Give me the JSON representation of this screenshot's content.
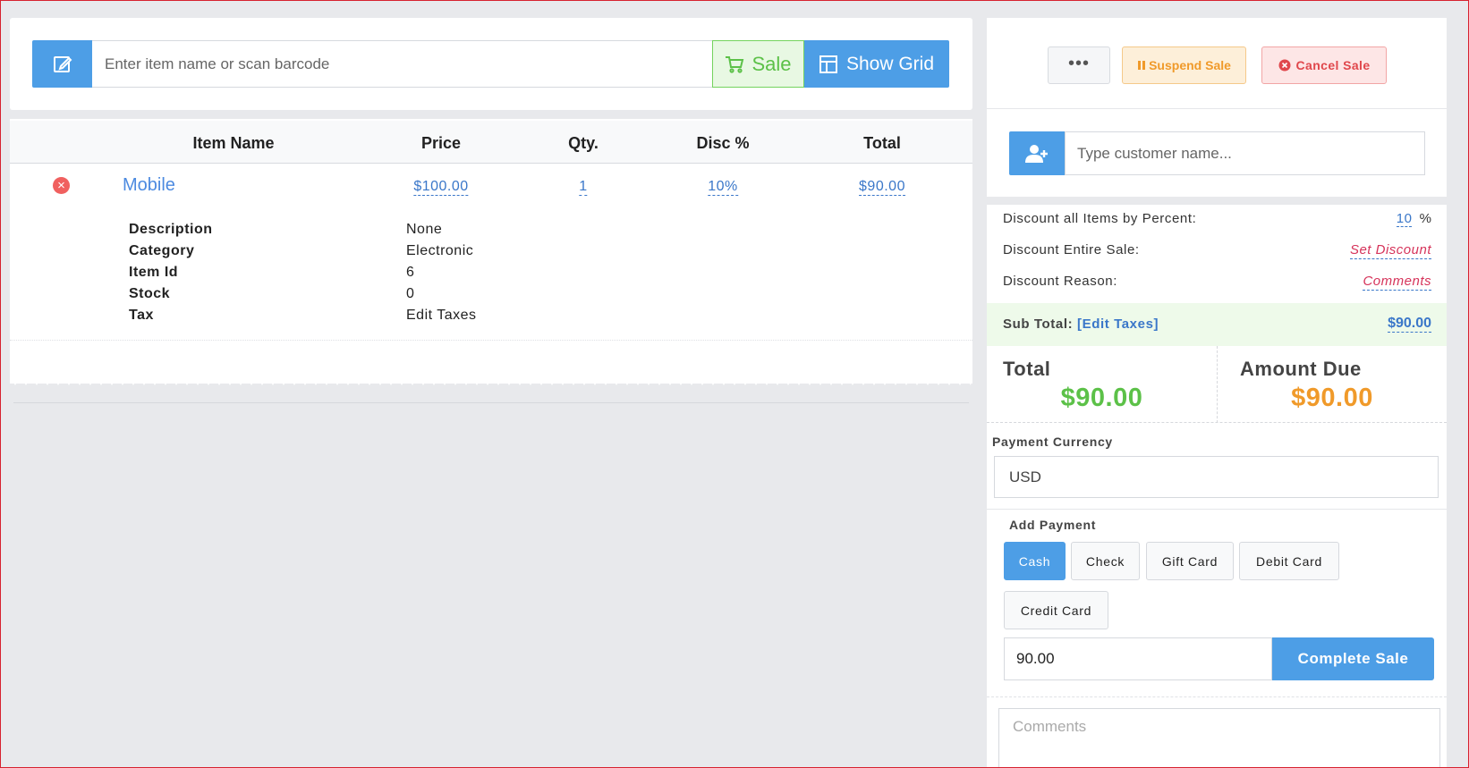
{
  "search": {
    "placeholder": "Enter item name or scan barcode",
    "sale_label": "Sale",
    "show_grid_label": "Show Grid"
  },
  "cart": {
    "columns": [
      "Item Name",
      "Price",
      "Qty.",
      "Disc %",
      "Total"
    ],
    "items": [
      {
        "name": "Mobile",
        "price": "$100.00",
        "qty": "1",
        "discount": "10%",
        "total": "$90.00",
        "details": [
          {
            "label": "Description",
            "value": "None"
          },
          {
            "label": "Category",
            "value": "Electronic"
          },
          {
            "label": "Item Id",
            "value": "6"
          },
          {
            "label": "Stock",
            "value": "0"
          },
          {
            "label": "Tax",
            "value": "Edit Taxes"
          }
        ]
      }
    ]
  },
  "actions": {
    "more_label": "•••",
    "suspend_label": "Suspend Sale",
    "cancel_label": "Cancel Sale"
  },
  "customer": {
    "placeholder": "Type customer name..."
  },
  "summary": {
    "discount_all_label": "Discount all Items by Percent:",
    "discount_all_value": "10",
    "percent_sign": "%",
    "discount_entire_label": "Discount Entire Sale:",
    "discount_entire_link": "Set Discount",
    "discount_reason_label": "Discount Reason:",
    "discount_reason_link": "Comments",
    "subtotal_label": "Sub Total:",
    "edit_taxes_label": "[Edit Taxes]",
    "subtotal_value": "$90.00",
    "total_label": "Total",
    "total_value": "$90.00",
    "amount_due_label": "Amount Due",
    "amount_due_value": "$90.00"
  },
  "payment": {
    "currency_label": "Payment Currency",
    "currency_value": "USD",
    "add_payment_label": "Add Payment",
    "types": [
      "Cash",
      "Check",
      "Gift Card",
      "Debit Card",
      "Credit Card"
    ],
    "active_type": "Cash",
    "amount_value": "90.00",
    "complete_label": "Complete Sale",
    "comments_placeholder": "Comments"
  },
  "colors": {
    "primary": "#4d9ee6",
    "success": "#5cc148",
    "warning": "#f09a2a",
    "danger": "#e0474c",
    "link": "#3a77c9"
  },
  "icons": {
    "edit": "edit-icon",
    "cart": "cart-icon",
    "grid": "grid-icon",
    "remove": "remove-icon",
    "pause": "pause-icon",
    "cancel": "cancel-icon",
    "add_user": "add-user-icon"
  }
}
